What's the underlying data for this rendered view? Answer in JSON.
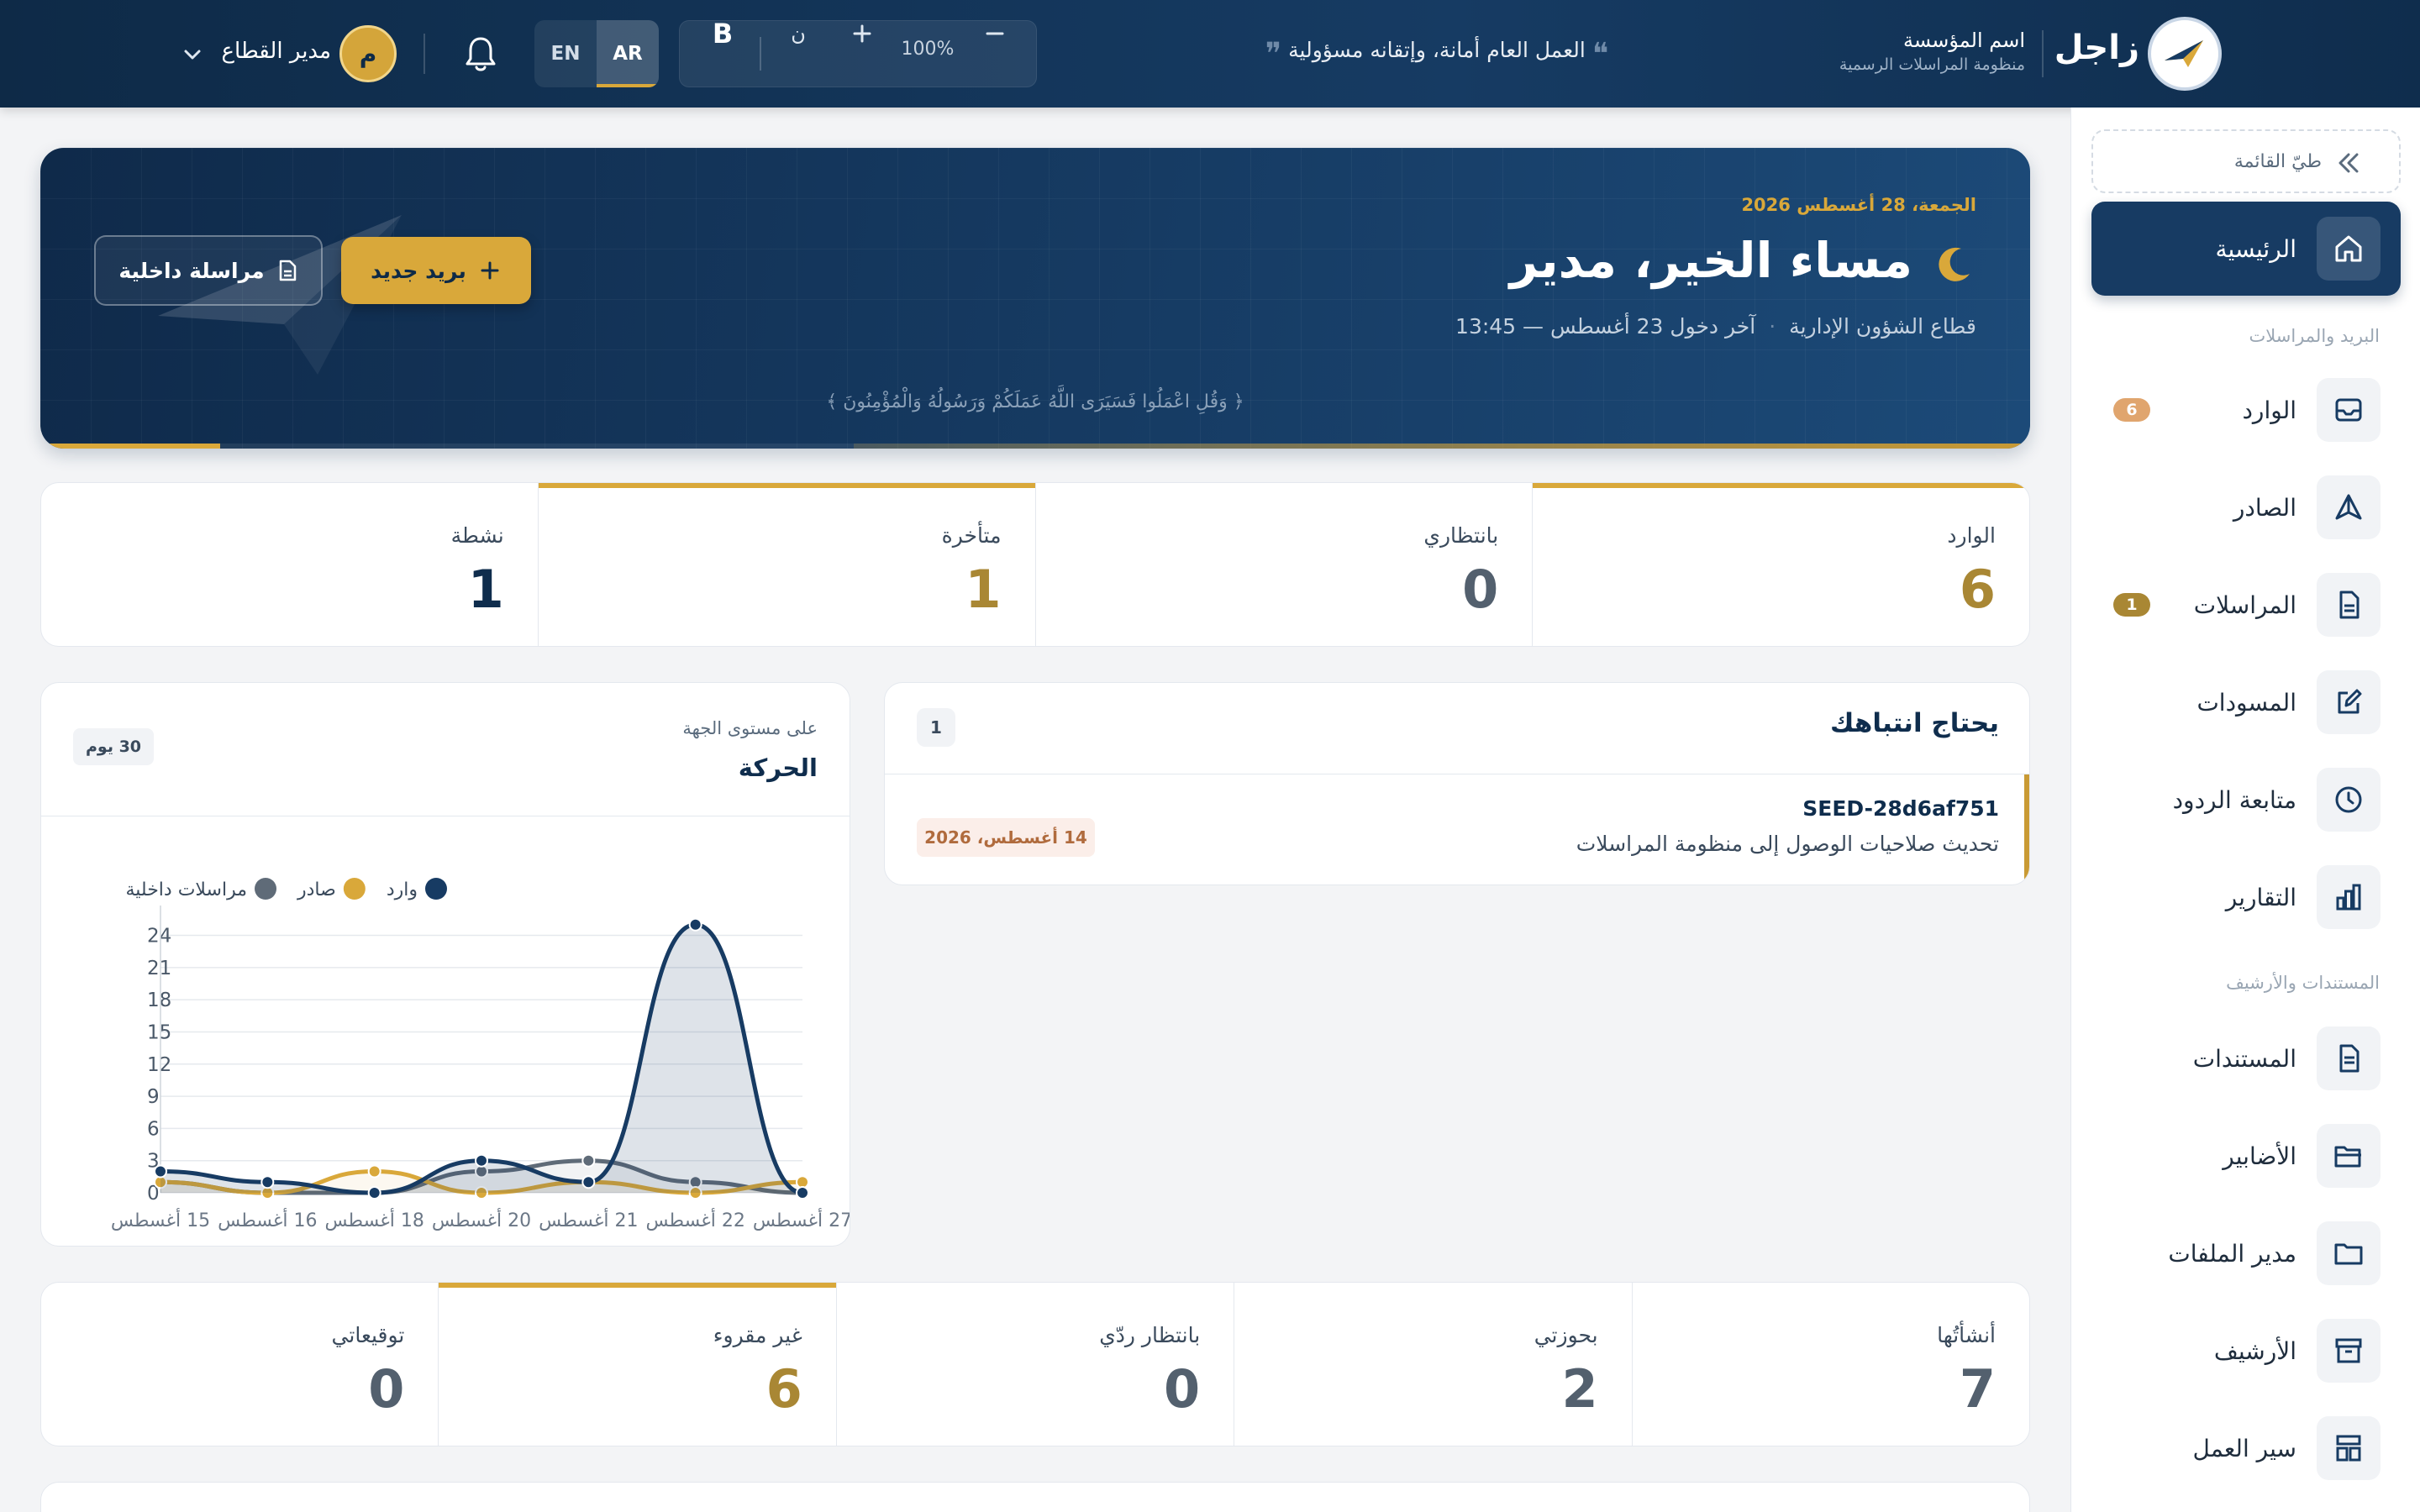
{
  "topbar": {
    "brand_name": "زاجل",
    "org_name": "اسم المؤسسة",
    "org_subtitle": "منظومة المراسلات الرسمية",
    "motto": "العمل العام أمانة، وإتقانه مسؤولية",
    "zoom": "100%",
    "font_label": "ن",
    "bold_label": "B",
    "lang_en": "EN",
    "lang_ar": "AR",
    "avatar_initial": "م",
    "user_name": "مدير القطاع"
  },
  "sidebar": {
    "collapse_label": "طيّ القائمة",
    "home_label": "الرئيسية",
    "section_mail": "البريد والمراسلات",
    "section_docs": "المستندات والأرشيف",
    "items": [
      {
        "label": "الوارد",
        "badge": "6",
        "icon": "inbox-icon"
      },
      {
        "label": "الصادر",
        "badge": "",
        "icon": "send-icon"
      },
      {
        "label": "المراسلات",
        "badge": "1",
        "icon": "document-icon"
      },
      {
        "label": "المسودات",
        "badge": "",
        "icon": "edit-icon"
      },
      {
        "label": "متابعة الردود",
        "badge": "",
        "icon": "clock-icon"
      },
      {
        "label": "التقارير",
        "badge": "",
        "icon": "bar-chart-icon"
      },
      {
        "label": "المستندات",
        "badge": "",
        "icon": "file-icon"
      },
      {
        "label": "الأضابير",
        "badge": "",
        "icon": "folder-open-icon"
      },
      {
        "label": "مدير الملفات",
        "badge": "",
        "icon": "folder-icon"
      },
      {
        "label": "الأرشيف",
        "badge": "",
        "icon": "archive-icon"
      },
      {
        "label": "سير العمل",
        "badge": "",
        "icon": "workflow-icon"
      }
    ]
  },
  "hero": {
    "date": "الجمعة، 28 أغسطس 2026",
    "greeting": "مساء الخير، مدير",
    "department": "قطاع الشؤون الإدارية",
    "last_login": "آخر دخول 23 أغسطس — 13:45",
    "verse": "﴿ وَقُلِ اعْمَلُوا فَسَيَرَى اللَّهُ عَمَلَكُمْ وَرَسُولُهُ وَالْمُؤْمِنُونَ ﴾",
    "new_mail_label": "بريد جديد",
    "internal_msg_label": "مراسلة داخلية"
  },
  "stats_top": [
    {
      "label": "الوارد",
      "value": "6"
    },
    {
      "label": "بانتظاري",
      "value": "0"
    },
    {
      "label": "متأخرة",
      "value": "1"
    },
    {
      "label": "نشطة",
      "value": "1"
    }
  ],
  "attention": {
    "title": "يحتاج انتباهك",
    "count": "1",
    "item_ref": "SEED-28d6af751",
    "item_subject": "تحديث صلاحيات الوصول إلى منظومة المراسلات",
    "item_date": "14 أغسطس، 2026"
  },
  "chart_card": {
    "subtitle": "على مستوى الجهة",
    "title": "الحركة",
    "range": "30 يوم"
  },
  "chart_data": {
    "type": "area",
    "x": [
      "15 أغسطس",
      "16 أغسطس",
      "18 أغسطس",
      "20 أغسطس",
      "21 أغسطس",
      "22 أغسطس",
      "27 أغسطس"
    ],
    "series": [
      {
        "name": "وارد",
        "values": [
          2,
          1,
          0,
          3,
          1,
          25,
          0
        ],
        "color": "#173b63"
      },
      {
        "name": "صادر",
        "values": [
          1,
          0,
          2,
          0,
          1,
          0,
          1
        ],
        "color": "#d9a83a"
      },
      {
        "name": "مراسلات داخلية",
        "values": [
          1,
          0,
          0,
          2,
          3,
          1,
          0
        ],
        "color": "#5f6b78"
      }
    ],
    "yticks": [
      0,
      3,
      6,
      9,
      12,
      15,
      18,
      21,
      24
    ],
    "ylim": [
      0,
      26
    ],
    "legend_position": "top-left",
    "grid": true
  },
  "stats_bottom": [
    {
      "label": "أنشأتُها",
      "value": "7"
    },
    {
      "label": "بحوزتي",
      "value": "2"
    },
    {
      "label": "بانتظار ردّي",
      "value": "0"
    },
    {
      "label": "غير مقروء",
      "value": "6"
    },
    {
      "label": "توقيعاتي",
      "value": "0"
    }
  ],
  "colors": {
    "navy": "#173b63",
    "gold": "#d9a83a",
    "slate": "#5f6b78"
  }
}
